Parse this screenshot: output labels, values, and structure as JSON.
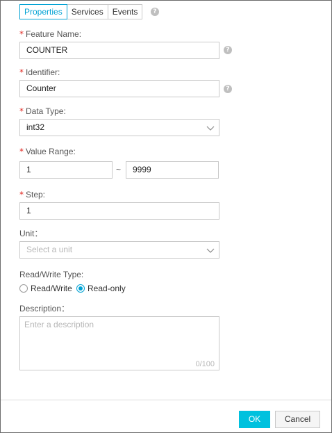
{
  "tabs": [
    {
      "label": "Properties",
      "active": true
    },
    {
      "label": "Services",
      "active": false
    },
    {
      "label": "Events",
      "active": false
    }
  ],
  "help_icon_glyph": "?",
  "required_mark": "*",
  "form": {
    "feature_name": {
      "label": "Feature Name:",
      "value": "COUNTER"
    },
    "identifier": {
      "label": "Identifier:",
      "value": "Counter"
    },
    "data_type": {
      "label": "Data Type:",
      "value": "int32"
    },
    "value_range": {
      "label": "Value Range:",
      "min": "1",
      "separator": "~",
      "max": "9999"
    },
    "step": {
      "label": "Step:",
      "value": "1"
    },
    "unit": {
      "label": "Unit：",
      "placeholder": "Select a unit"
    },
    "read_write_type": {
      "label": "Read/Write Type:",
      "options": [
        {
          "label": "Read/Write",
          "checked": false
        },
        {
          "label": "Read-only",
          "checked": true
        }
      ]
    },
    "description": {
      "label": "Description：",
      "placeholder": "Enter a description",
      "counter": "0/100"
    }
  },
  "footer": {
    "ok_label": "OK",
    "cancel_label": "Cancel"
  },
  "colors": {
    "accent": "#00a2d4",
    "ok_button": "#00c1de",
    "required": "#e0261f",
    "help_icon": "#bfbfbf"
  },
  "icons": {
    "help": "question-circle-icon",
    "dropdown": "chevron-down-icon"
  }
}
